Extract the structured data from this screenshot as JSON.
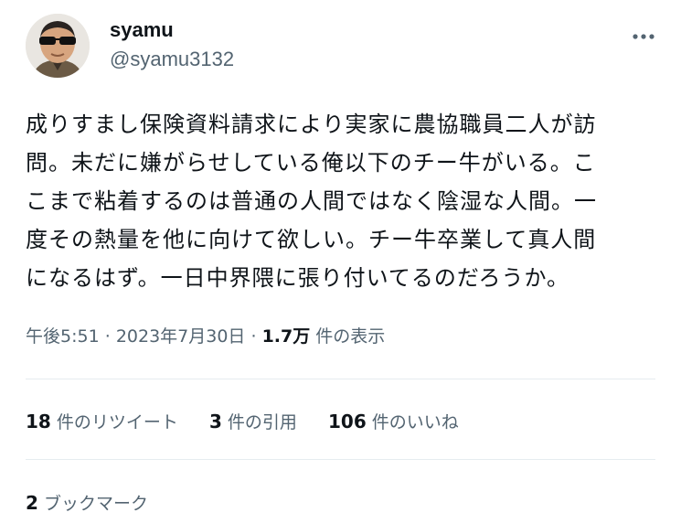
{
  "author": {
    "display_name": "syamu",
    "handle": "@syamu3132"
  },
  "more_icon": "more-horizontal-icon",
  "tweet": {
    "lines": [
      "成りすまし保険資料請求により実家に農協職員二人が訪",
      "問。未だに嫌がらせしている俺以下のチー牛がいる。こ",
      "こまで粘着するのは普通の人間ではなく陰湿な人間。一",
      "度その熱量を他に向けて欲しい。チー牛卒業して真人間",
      "になるはず。一日中界隈に張り付いてるのだろうか。"
    ]
  },
  "meta": {
    "time": "午後5:51",
    "sep1": "·",
    "date": "2023年7月30日",
    "sep2": "·",
    "views_count": "1.7万",
    "views_label": "件の表示"
  },
  "stats": {
    "retweets_count": "18",
    "retweets_label": "件のリツイート",
    "quotes_count": "3",
    "quotes_label": "件の引用",
    "likes_count": "106",
    "likes_label": "件のいいね"
  },
  "bookmarks": {
    "count": "2",
    "label": "ブックマーク"
  },
  "colors": {
    "text": "#0f1419",
    "secondary": "#536471",
    "divider": "#e6ecf0"
  }
}
